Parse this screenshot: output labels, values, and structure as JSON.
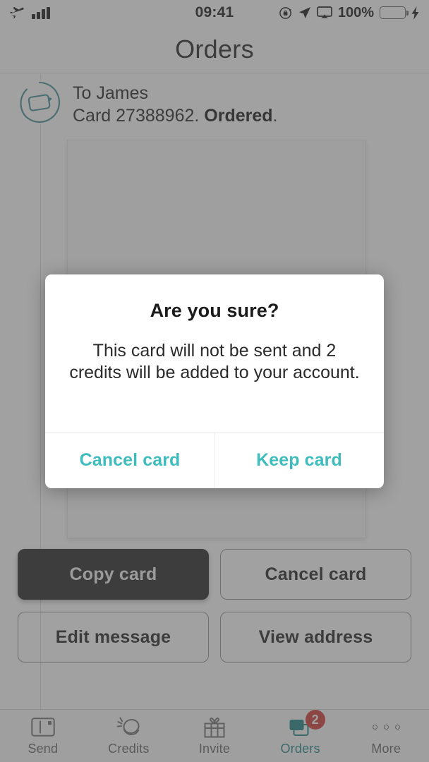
{
  "status_bar": {
    "airplane_icon": "airplane-mode",
    "signal_icon": "signal-bars",
    "time": "09:41",
    "rotation_lock_icon": "rotation-lock",
    "location_icon": "location-arrow",
    "airplay_icon": "screen-mirroring",
    "battery_percent": "100%",
    "battery_color": "#44dd55",
    "charging_icon": "lightning-bolt"
  },
  "nav": {
    "title": "Orders"
  },
  "order": {
    "icon": "card-in-circle-icon",
    "recipient_line": "To James",
    "card_label": "Card ",
    "card_number": "27388962",
    "card_separator": ". ",
    "status": "Ordered",
    "status_period": "."
  },
  "actions": [
    {
      "label": "Copy card",
      "name": "copy-card-button",
      "primary": true
    },
    {
      "label": "Cancel card",
      "name": "cancel-card-button",
      "primary": false
    },
    {
      "label": "Edit message",
      "name": "edit-message-button",
      "primary": false
    },
    {
      "label": "View address",
      "name": "view-address-button",
      "primary": false
    }
  ],
  "dialog": {
    "title": "Are you sure?",
    "message": "This card will not be sent and 2 credits will be added to your account.",
    "cancel_label": "Cancel card",
    "keep_label": "Keep card",
    "accent_color": "#3fbcbd"
  },
  "tab_bar": {
    "active": "Orders",
    "active_color": "#17807f",
    "badge_color": "#d0342c",
    "items": [
      {
        "label": "Send",
        "icon": "postcard-icon",
        "badge": ""
      },
      {
        "label": "Credits",
        "icon": "coin-icon",
        "badge": ""
      },
      {
        "label": "Invite",
        "icon": "gift-icon",
        "badge": ""
      },
      {
        "label": "Orders",
        "icon": "stacked-cards-icon",
        "badge": "2"
      },
      {
        "label": "More",
        "icon": "ellipsis-icon",
        "badge": ""
      }
    ]
  }
}
